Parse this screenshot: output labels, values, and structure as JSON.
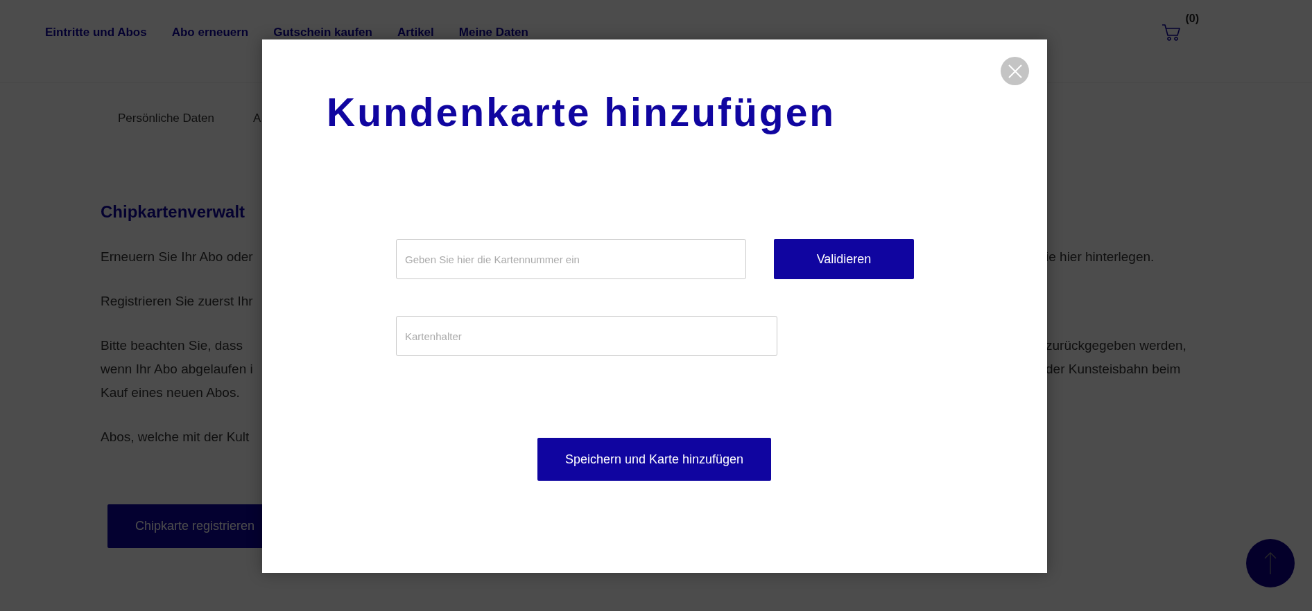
{
  "nav": {
    "items": [
      {
        "label": "Eintritte und Abos"
      },
      {
        "label": "Abo erneuern"
      },
      {
        "label": "Gutschein kaufen"
      },
      {
        "label": "Artikel"
      },
      {
        "label": "Meine Daten"
      }
    ],
    "cart": {
      "count": "(0)"
    }
  },
  "subtabs": [
    {
      "label": "Persönliche Daten"
    },
    {
      "label": "A"
    }
  ],
  "content": {
    "heading": "Chipkartenverwalt",
    "paragraphs": [
      {
        "lines": [
          {
            "left": "Erneuern Sie Ihr Abo oder",
            "right": "ie hier hinterlegen."
          }
        ]
      },
      {
        "lines": [
          {
            "left": "Registrieren Sie zuerst Ihr"
          }
        ]
      },
      {
        "lines": [
          {
            "left": "Bitte beachten Sie, dass",
            "right": "zurückgegeben werden,"
          },
          {
            "left": "wenn Ihr Abo abgelaufen i",
            "right": "der Kunsteisbahn beim"
          },
          {
            "left": "Kauf eines neuen Abos."
          }
        ]
      },
      {
        "lines": [
          {
            "left": "Abos, welche mit der Kult"
          }
        ]
      }
    ],
    "button": "Chipkarte registrieren"
  },
  "modal": {
    "title": "Kundenkarte hinzufügen",
    "fields": [
      {
        "placeholder": "Geben Sie hier die Kartennummer ein"
      },
      {
        "placeholder": "Kartenhalter"
      }
    ],
    "validate_button": "Validieren",
    "save_button": "Speichern und Karte hinzufügen"
  }
}
